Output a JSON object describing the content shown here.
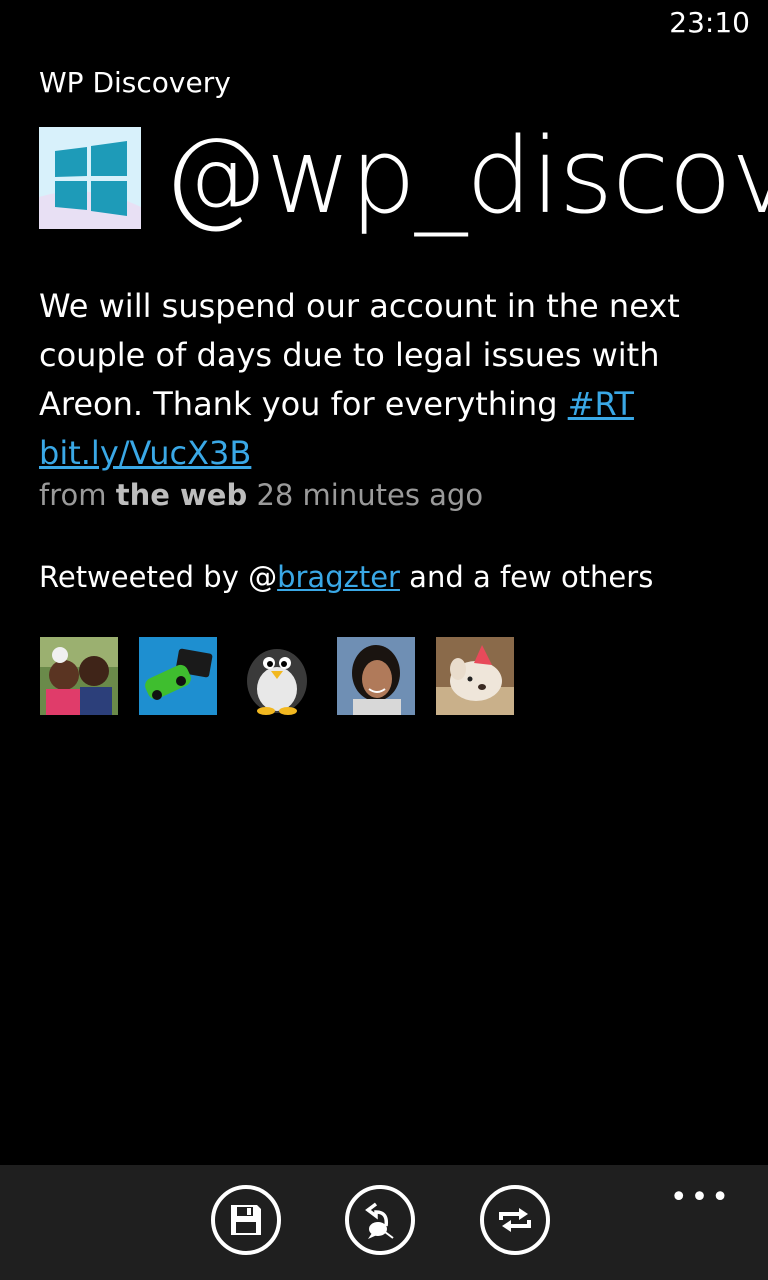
{
  "status_bar": {
    "time": "23:10"
  },
  "app": {
    "name": "WP Discovery"
  },
  "profile": {
    "handle": "@wp_discov",
    "picture_icon": "windows-logo-icon"
  },
  "tweet": {
    "text_before": "We will suspend our account in the next couple of days due to legal issues with Areon. Thank you for everything ",
    "hashtag": "#RT",
    "link": "bit.ly/VucX3B",
    "from_label": "from",
    "source": "the web",
    "time_ago": "28 minutes ago"
  },
  "retweets": {
    "prefix": "Retweeted by @",
    "user": "bragzter",
    "suffix": " and a few others",
    "avatars": [
      {
        "name": "avatar-family-photo"
      },
      {
        "name": "avatar-green-car"
      },
      {
        "name": "avatar-penguin"
      },
      {
        "name": "avatar-woman"
      },
      {
        "name": "avatar-puppy"
      }
    ]
  },
  "app_bar": {
    "buttons": [
      {
        "icon": "save-icon"
      },
      {
        "icon": "reply-icon"
      },
      {
        "icon": "retweet-icon"
      }
    ],
    "more_label": "•••"
  },
  "colors": {
    "accent_link": "#3aa8e6",
    "appbar_bg": "#1f1f1f",
    "meta_gray": "#9a9a9a"
  }
}
